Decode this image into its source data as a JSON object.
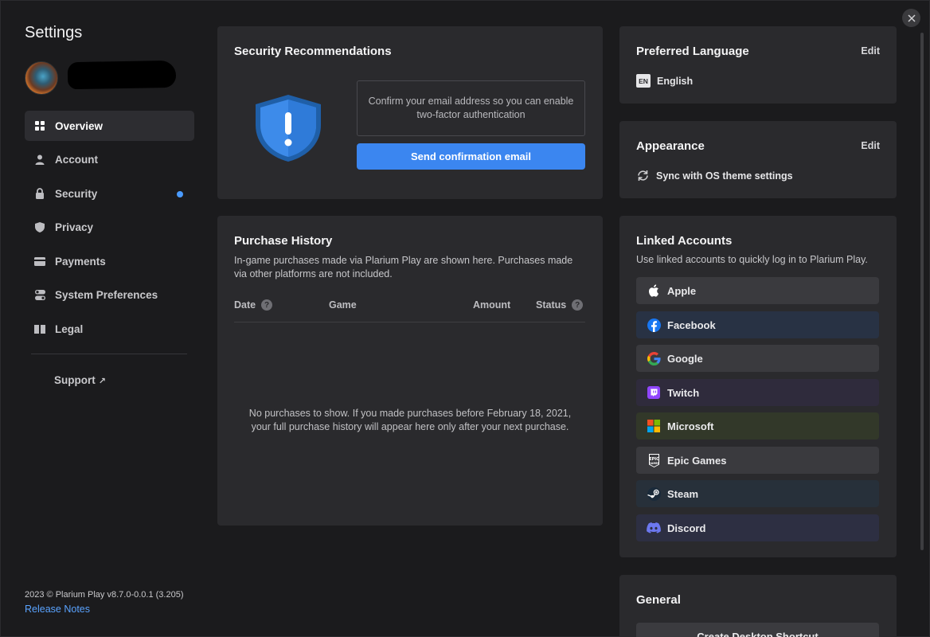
{
  "sidebar": {
    "title": "Settings",
    "items": [
      {
        "label": "Overview",
        "icon": "grid-icon"
      },
      {
        "label": "Account",
        "icon": "user-icon"
      },
      {
        "label": "Security",
        "icon": "lock-icon",
        "badge_color": "#4a9bff"
      },
      {
        "label": "Privacy",
        "icon": "shield-icon"
      },
      {
        "label": "Payments",
        "icon": "card-icon"
      },
      {
        "label": "System Preferences",
        "icon": "toggle-icon"
      },
      {
        "label": "Legal",
        "icon": "book-icon"
      }
    ],
    "support": "Support",
    "support_arrow": "↗",
    "version": "2023 © Plarium Play v8.7.0-0.0.1 (3.205)",
    "release_notes": "Release Notes"
  },
  "security": {
    "title": "Security Recommendations",
    "message": "Confirm your email address so you can enable two-factor authentication",
    "button": "Send confirmation email"
  },
  "purchase": {
    "title": "Purchase History",
    "description": "In-game purchases made via Plarium Play are shown here. Purchases made via other platforms are not included.",
    "columns": [
      "Date",
      "Game",
      "Amount",
      "Status"
    ],
    "empty": "No purchases to show. If you made purchases before February 18, 2021, your full purchase history will appear here only after your next purchase."
  },
  "language": {
    "title": "Preferred Language",
    "edit": "Edit",
    "badge": "EN",
    "value": "English"
  },
  "appearance": {
    "title": "Appearance",
    "edit": "Edit",
    "value": "Sync with OS theme settings"
  },
  "linked": {
    "title": "Linked Accounts",
    "description": "Use linked accounts to quickly log in to Plarium Play.",
    "accounts": [
      {
        "label": "Apple",
        "bg": "#3a3a3e"
      },
      {
        "label": "Facebook",
        "bg": "#283244"
      },
      {
        "label": "Google",
        "bg": "#3a3a3e"
      },
      {
        "label": "Twitch",
        "bg": "#2f2b3c"
      },
      {
        "label": "Microsoft",
        "bg": "#323829"
      },
      {
        "label": "Epic Games",
        "bg": "#3a3a3e"
      },
      {
        "label": "Steam",
        "bg": "#27303a"
      },
      {
        "label": "Discord",
        "bg": "#2d2f42"
      }
    ]
  },
  "general": {
    "title": "General",
    "button": "Create Desktop Shortcut"
  },
  "colors": {
    "accent": "#3b86f0",
    "background": "#1b1b1d",
    "card": "#2a2a2d"
  }
}
